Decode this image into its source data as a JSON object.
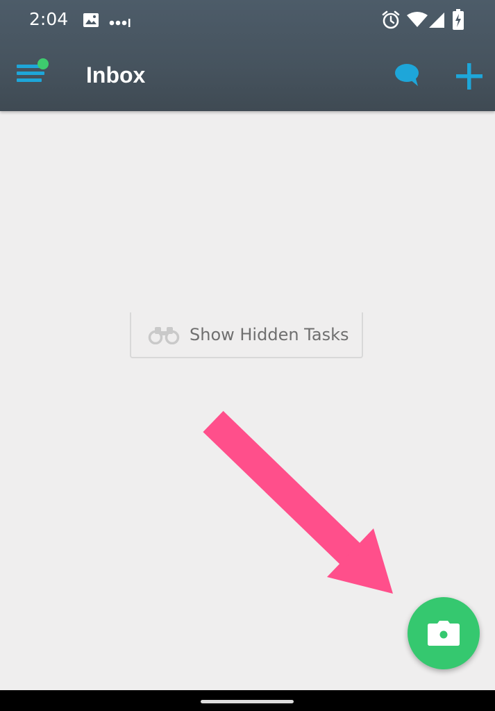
{
  "status_bar": {
    "time": "2:04",
    "icons": [
      "image-icon",
      "more-dots-icon",
      "alarm-icon",
      "wifi-icon",
      "signal-icon",
      "battery-charging-icon"
    ]
  },
  "app_bar": {
    "title": "Inbox",
    "menu_icon": "menu-icon",
    "notification_dot_color": "#3ecb6e",
    "chat_icon": "chat-bubble-icon",
    "add_icon": "plus-icon",
    "accent_color": "#1ea6d9"
  },
  "content": {
    "show_hidden_label": "Show Hidden Tasks",
    "show_hidden_icon": "binoculars-icon"
  },
  "annotation": {
    "arrow_color": "#ff4f8b"
  },
  "fab": {
    "icon": "camera-icon",
    "color": "#35c86f"
  }
}
